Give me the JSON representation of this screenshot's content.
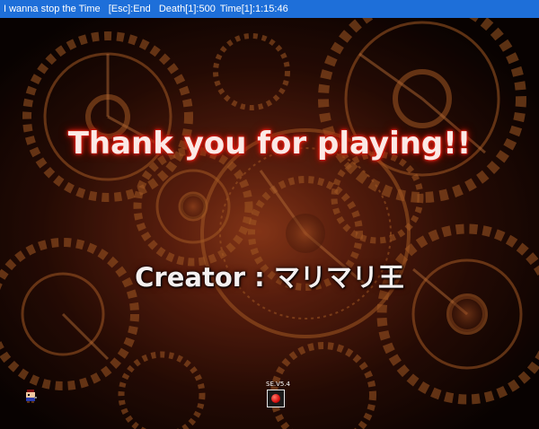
{
  "window": {
    "title": "I wanna stop the Time",
    "esc_hint": "[Esc]:End",
    "death": "Death[1]:500",
    "time": "Time[1]:1:15:46",
    "titlebar_color": "#1e6fd9"
  },
  "screen": {
    "heading": "Thank you for playing!!",
    "creator_label": "Creator : マリマリ王",
    "heading_glow_color": "#e02010"
  },
  "hud": {
    "save_label": "SE.V5.4",
    "player_icon": "kid-sprite-icon",
    "save_icon": "save-point-icon"
  }
}
